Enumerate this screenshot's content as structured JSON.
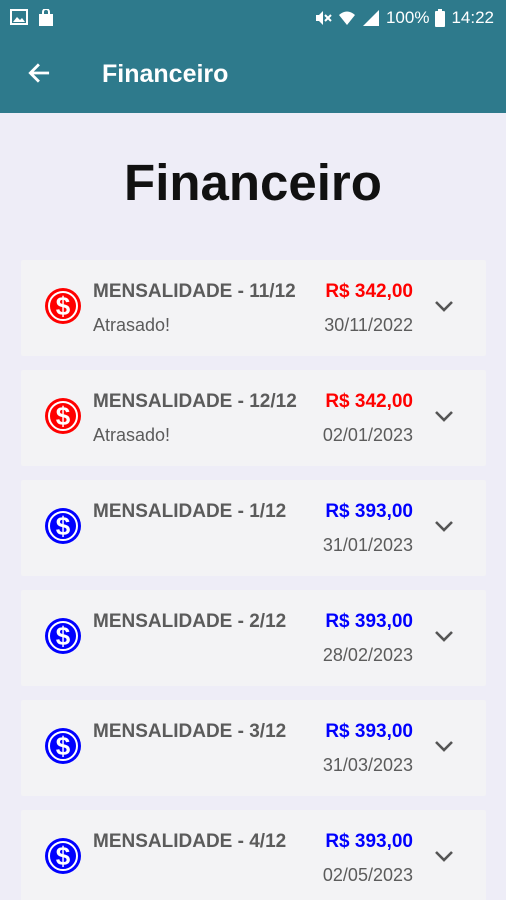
{
  "status_bar": {
    "battery": "100%",
    "time": "14:22"
  },
  "app_bar": {
    "title": "Financeiro"
  },
  "page": {
    "heading": "Financeiro"
  },
  "colors": {
    "primary": "#2e7a8c",
    "overdue": "#ff0000",
    "pending": "#0000ff"
  },
  "payments": [
    {
      "title": "MENSALIDADE - 11/12",
      "status": "Atrasado!",
      "amount": "R$ 342,00",
      "date": "30/11/2022",
      "state": "overdue"
    },
    {
      "title": "MENSALIDADE - 12/12",
      "status": "Atrasado!",
      "amount": "R$ 342,00",
      "date": "02/01/2023",
      "state": "overdue"
    },
    {
      "title": "MENSALIDADE - 1/12",
      "status": "",
      "amount": "R$ 393,00",
      "date": "31/01/2023",
      "state": "pending"
    },
    {
      "title": "MENSALIDADE - 2/12",
      "status": "",
      "amount": "R$ 393,00",
      "date": "28/02/2023",
      "state": "pending"
    },
    {
      "title": "MENSALIDADE - 3/12",
      "status": "",
      "amount": "R$ 393,00",
      "date": "31/03/2023",
      "state": "pending"
    },
    {
      "title": "MENSALIDADE - 4/12",
      "status": "",
      "amount": "R$ 393,00",
      "date": "02/05/2023",
      "state": "pending"
    }
  ]
}
